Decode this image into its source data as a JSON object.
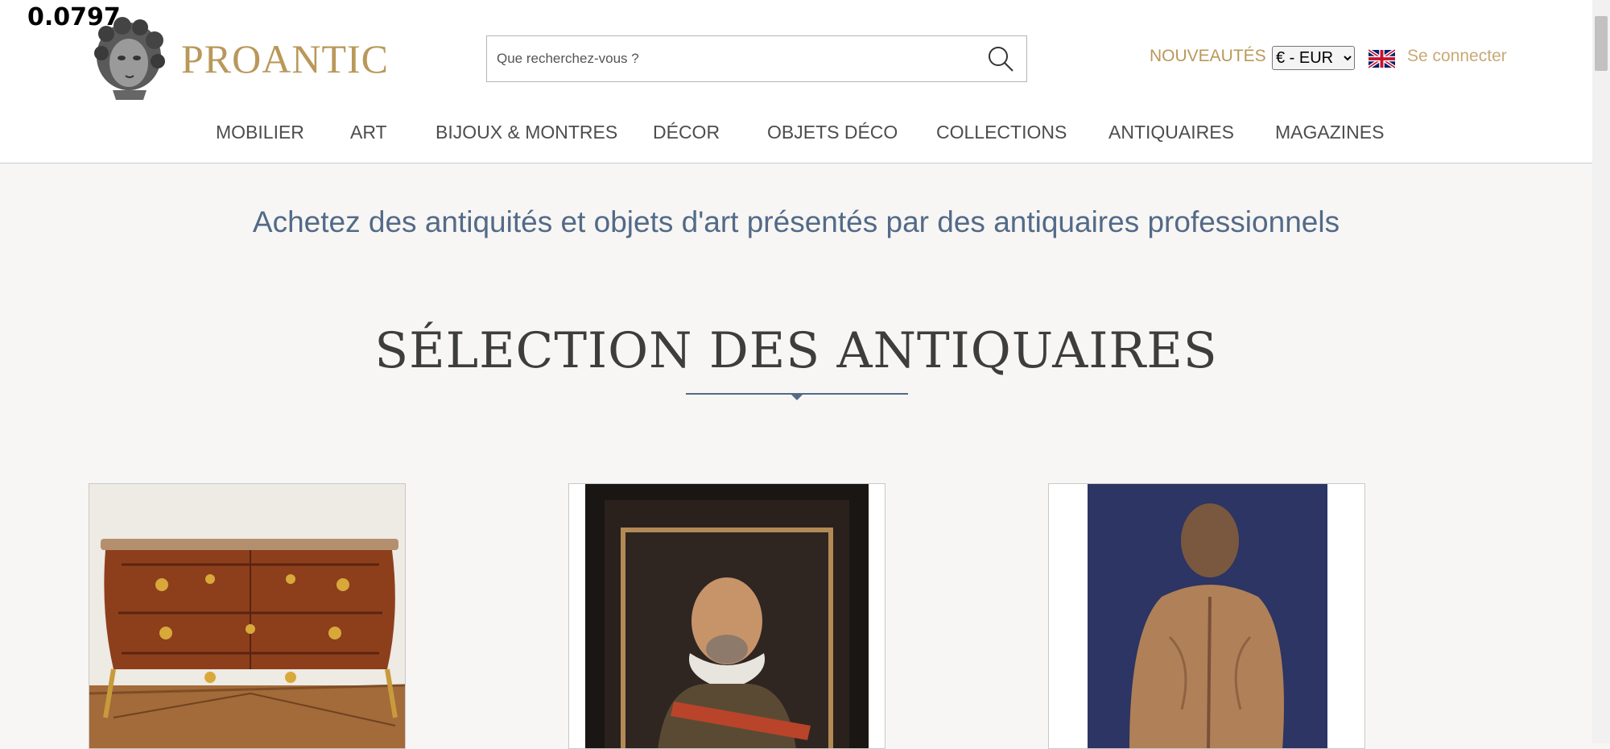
{
  "overlay": {
    "value": "0.0797"
  },
  "brand": {
    "name": "PROANTIC"
  },
  "search": {
    "placeholder": "Que recherchez-vous ?",
    "value": ""
  },
  "header": {
    "new_label": "NOUVEAUTÉS",
    "currency_selected": "€ - EUR",
    "login_label": "Se connecter"
  },
  "nav": {
    "items": [
      {
        "label": "MOBILIER"
      },
      {
        "label": "ART"
      },
      {
        "label": "BIJOUX & MONTRES"
      },
      {
        "label": "DÉCOR"
      },
      {
        "label": "OBJETS DÉCO"
      },
      {
        "label": "COLLECTIONS"
      },
      {
        "label": "ANTIQUAIRES"
      },
      {
        "label": "MAGAZINES"
      }
    ]
  },
  "main": {
    "tagline": "Achetez des antiquités et objets d'art présentés par des antiquaires professionnels",
    "section_title": "SÉLECTION DES ANTIQUAIRES"
  },
  "colors": {
    "gold": "#b9985a",
    "gold_light": "#c9a977",
    "tagline_blue": "#536a88",
    "background": "#f7f6f4"
  },
  "icons": [
    "search-icon",
    "uk-flag-icon",
    "logo-bust-icon"
  ]
}
